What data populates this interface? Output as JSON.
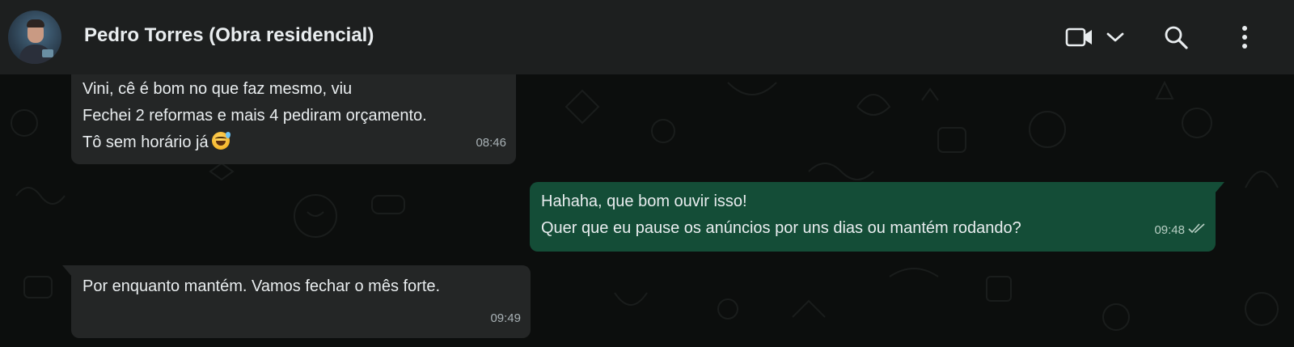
{
  "header": {
    "contact_name": "Pedro Torres (Obra residencial)",
    "avatar_icon": "avatar-photo",
    "icons": [
      "video-call-icon",
      "chevron-down-icon",
      "search-icon",
      "more-options-icon"
    ]
  },
  "messages": [
    {
      "direction": "incoming",
      "text": "Vini, cê é bom no que faz mesmo, viu\nFechei 2 reformas e mais 4 pediram orçamento.\nTô sem horário já",
      "emoji": "grinning-face-with-sweat",
      "time": "08:46"
    },
    {
      "direction": "outgoing",
      "text": "Hahaha, que bom ouvir isso!\nQuer que eu pause os anúncios por uns dias ou mantém rodando?",
      "time": "09:48",
      "status": "read-double-check-icon"
    },
    {
      "direction": "incoming",
      "text": "Por enquanto mantém. Vamos fechar o mês forte.",
      "time": "09:49"
    }
  ],
  "colors": {
    "header_bg": "#1d1f1f",
    "chat_bg": "#0c0e0d",
    "incoming_bubble": "#242626",
    "outgoing_bubble": "#144d37",
    "text": "#e9edef",
    "timestamp": "#a9b2b6"
  }
}
